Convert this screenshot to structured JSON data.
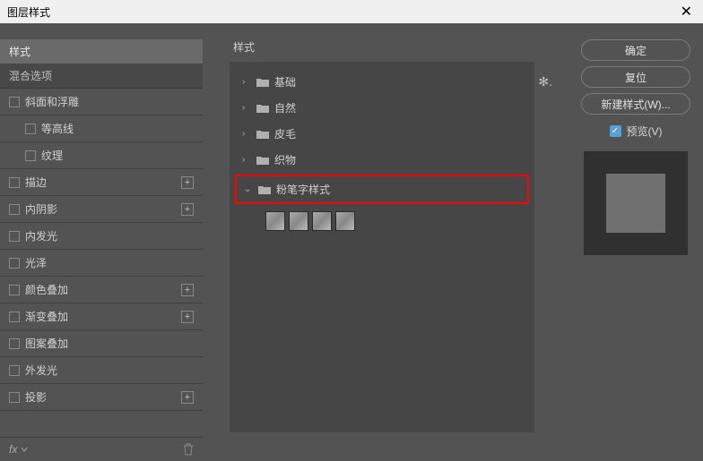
{
  "window": {
    "title": "图层样式"
  },
  "left": {
    "header": "样式",
    "blend": "混合选项",
    "items": [
      {
        "label": "斜面和浮雕",
        "plus": false,
        "indent": false
      },
      {
        "label": "等高线",
        "plus": false,
        "indent": true
      },
      {
        "label": "纹理",
        "plus": false,
        "indent": true
      },
      {
        "label": "描边",
        "plus": true,
        "indent": false
      },
      {
        "label": "内阴影",
        "plus": true,
        "indent": false
      },
      {
        "label": "内发光",
        "plus": false,
        "indent": false
      },
      {
        "label": "光泽",
        "plus": false,
        "indent": false
      },
      {
        "label": "颜色叠加",
        "plus": true,
        "indent": false
      },
      {
        "label": "渐变叠加",
        "plus": true,
        "indent": false
      },
      {
        "label": "图案叠加",
        "plus": false,
        "indent": false
      },
      {
        "label": "外发光",
        "plus": false,
        "indent": false
      },
      {
        "label": "投影",
        "plus": true,
        "indent": false
      }
    ],
    "fx": "fx"
  },
  "center": {
    "title": "样式",
    "folders": [
      {
        "label": "基础",
        "expanded": false
      },
      {
        "label": "自然",
        "expanded": false
      },
      {
        "label": "皮毛",
        "expanded": false
      },
      {
        "label": "织物",
        "expanded": false
      }
    ],
    "highlighted_folder": {
      "label": "粉笔字样式",
      "expanded": true
    }
  },
  "right": {
    "ok": "确定",
    "reset": "复位",
    "newstyle": "新建样式(W)...",
    "preview": "预览(V)"
  }
}
